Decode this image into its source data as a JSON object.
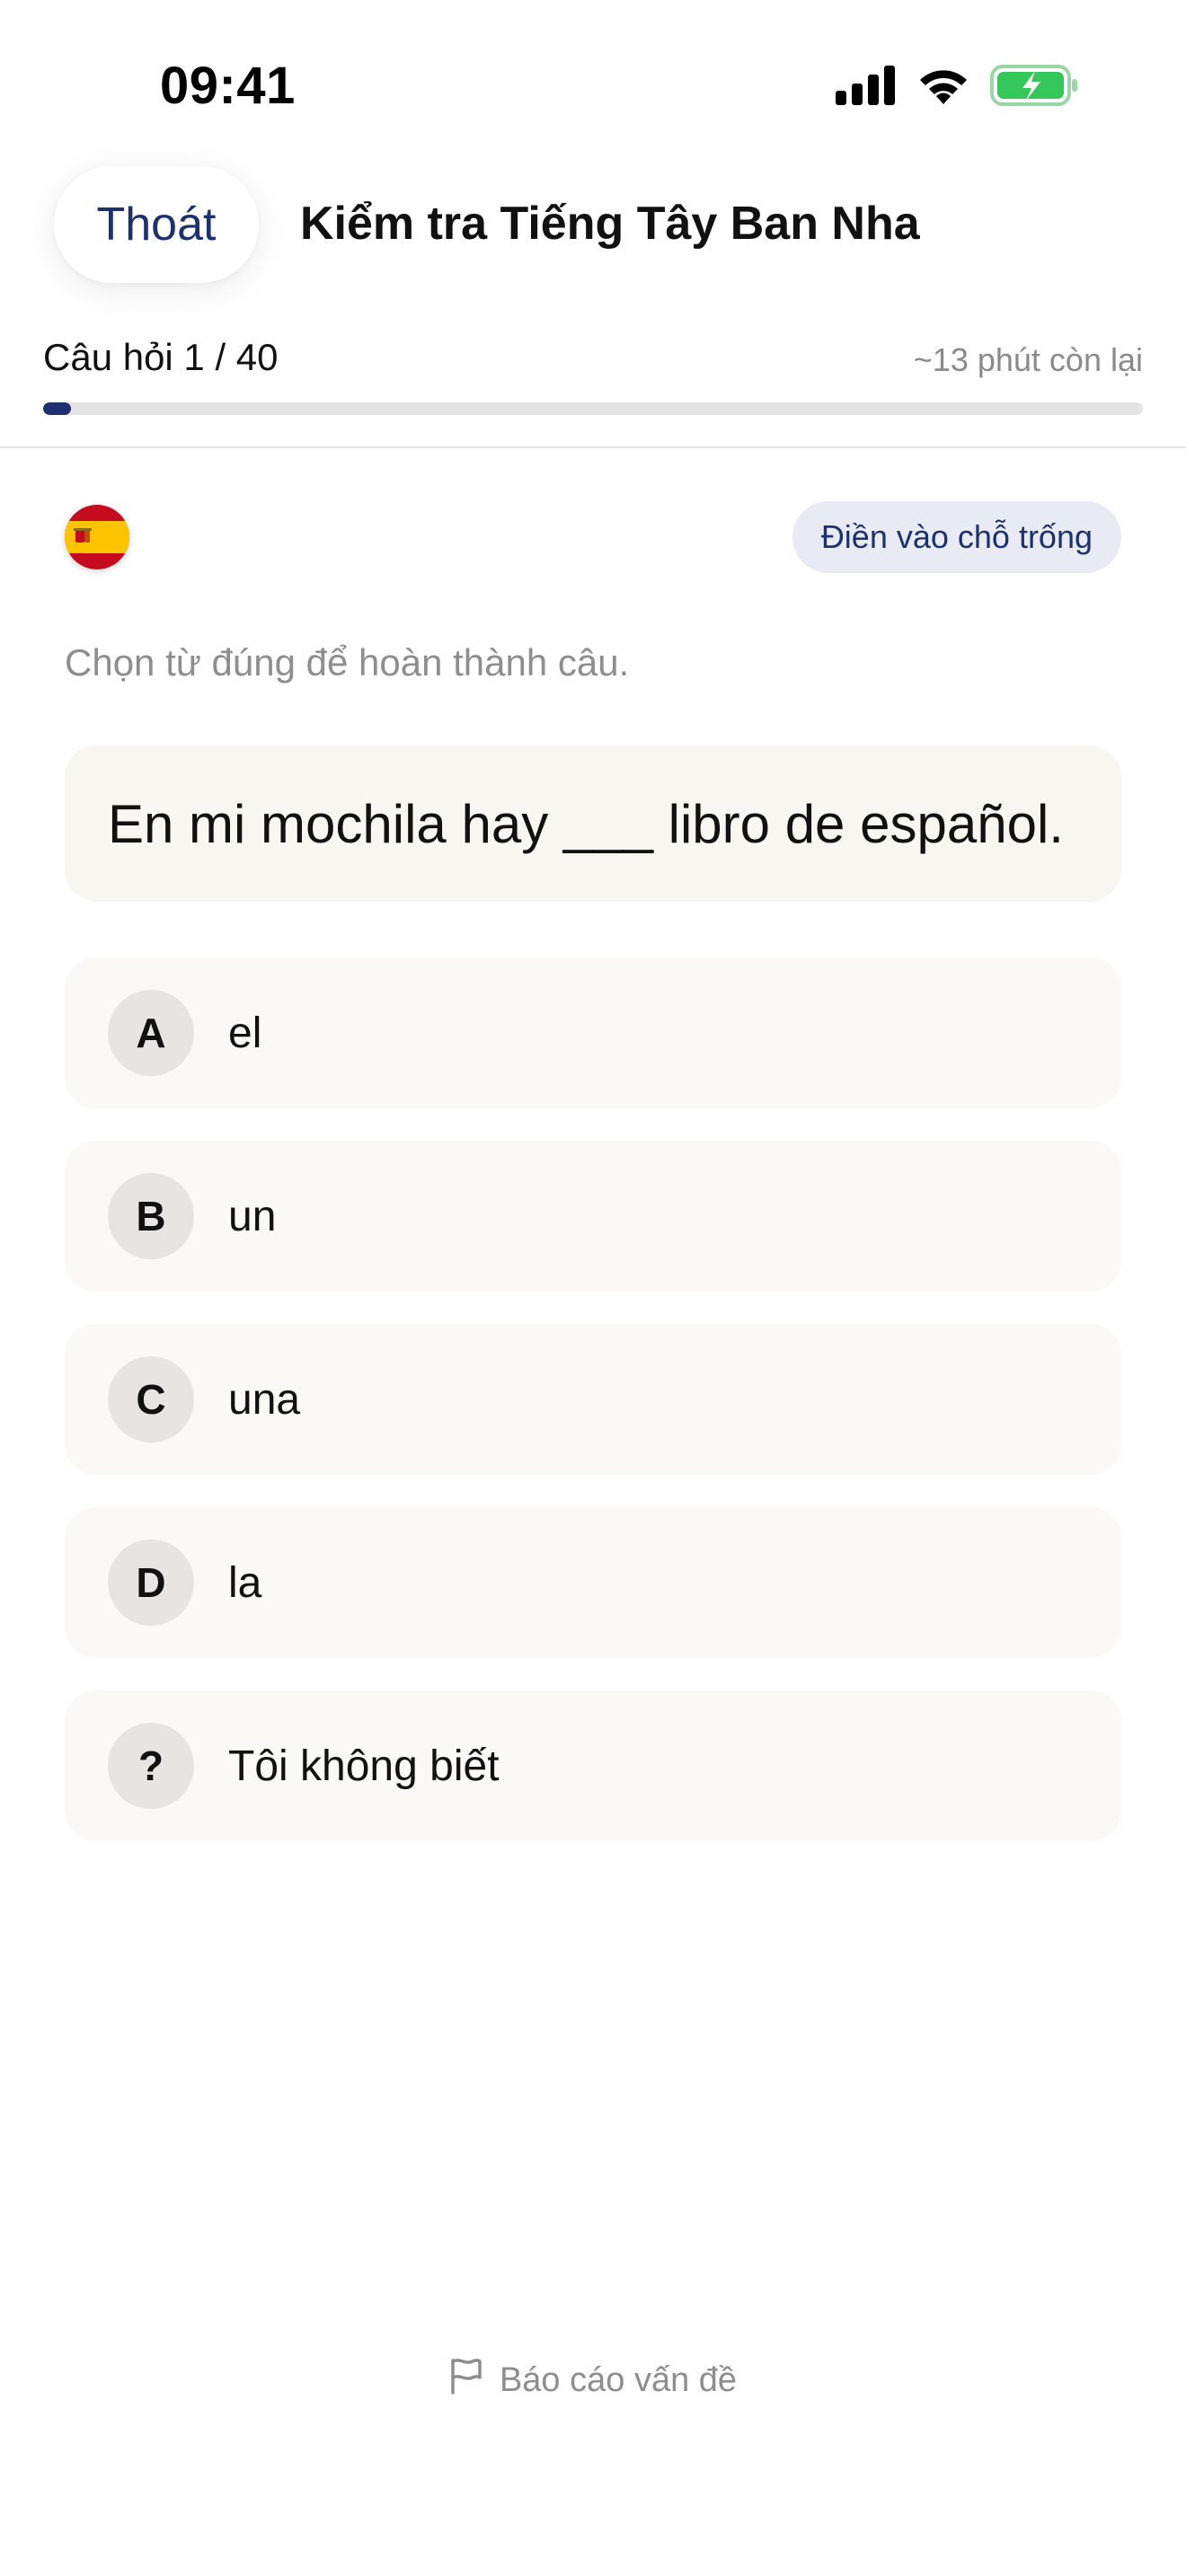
{
  "status_bar": {
    "time": "09:41",
    "icons": [
      "signal-icon",
      "wifi-icon",
      "battery-charging-icon"
    ],
    "battery_color": "#34c759"
  },
  "header": {
    "exit_label": "Thoát",
    "title": "Kiểm tra Tiếng Tây Ban Nha"
  },
  "progress": {
    "label": "Câu hỏi 1 / 40",
    "current": 1,
    "total": 40,
    "time_remaining": "~13 phút còn lại",
    "accent_color": "#1d3170"
  },
  "question": {
    "flag": "spain-flag-icon",
    "type_badge": "Điền vào chỗ trống",
    "instruction": "Chọn từ đúng để hoàn thành câu.",
    "sentence": "En mi mochila hay ___ libro de español."
  },
  "options": [
    {
      "letter": "A",
      "text": "el"
    },
    {
      "letter": "B",
      "text": "un"
    },
    {
      "letter": "C",
      "text": "una"
    },
    {
      "letter": "D",
      "text": "la"
    },
    {
      "letter": "?",
      "text": "Tôi không biết"
    }
  ],
  "footer": {
    "report_icon": "flag-icon",
    "report_label": "Báo cáo vấn đề"
  }
}
